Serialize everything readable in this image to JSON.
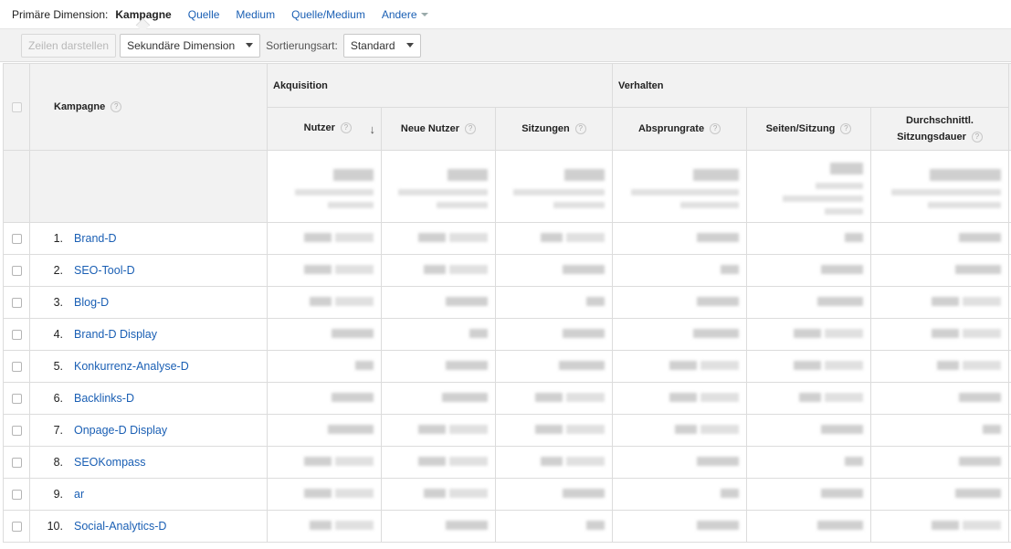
{
  "primary_dimension": {
    "label": "Primäre Dimension:",
    "options": [
      "Kampagne",
      "Quelle",
      "Medium",
      "Quelle/Medium",
      "Andere"
    ],
    "active": "Kampagne"
  },
  "toolbar": {
    "plot_rows": "Zeilen darstellen",
    "secondary_dimension": "Sekundäre Dimension",
    "sort_label": "Sortierungsart:",
    "sort_value": "Standard"
  },
  "table": {
    "campaign_header": "Kampagne",
    "groups": {
      "acquisition": "Akquisition",
      "behavior": "Verhalten"
    },
    "columns": {
      "users": "Nutzer",
      "new_users": "Neue Nutzer",
      "sessions": "Sitzungen",
      "bounce_rate": "Absprungrate",
      "pages_per_session": "Seiten/Sitzung",
      "avg_duration_line1": "Durchschnittl.",
      "avg_duration_line2": "Sitzungsdauer"
    },
    "help_glyph": "?",
    "sort_arrow": "↓",
    "rows": [
      {
        "num": "1.",
        "name": "Brand-D"
      },
      {
        "num": "2.",
        "name": "SEO-Tool-D"
      },
      {
        "num": "3.",
        "name": "Blog-D"
      },
      {
        "num": "4.",
        "name": "Brand-D Display"
      },
      {
        "num": "5.",
        "name": "Konkurrenz-Analyse-D"
      },
      {
        "num": "6.",
        "name": "Backlinks-D"
      },
      {
        "num": "7.",
        "name": "Onpage-D Display"
      },
      {
        "num": "8.",
        "name": "SEOKompass"
      },
      {
        "num": "9.",
        "name": "ar"
      },
      {
        "num": "10.",
        "name": "Social-Analytics-D"
      }
    ]
  },
  "colors": {
    "link": "#1a5fb4",
    "header_bg": "#f2f2f2",
    "border": "#dcdcdc"
  }
}
